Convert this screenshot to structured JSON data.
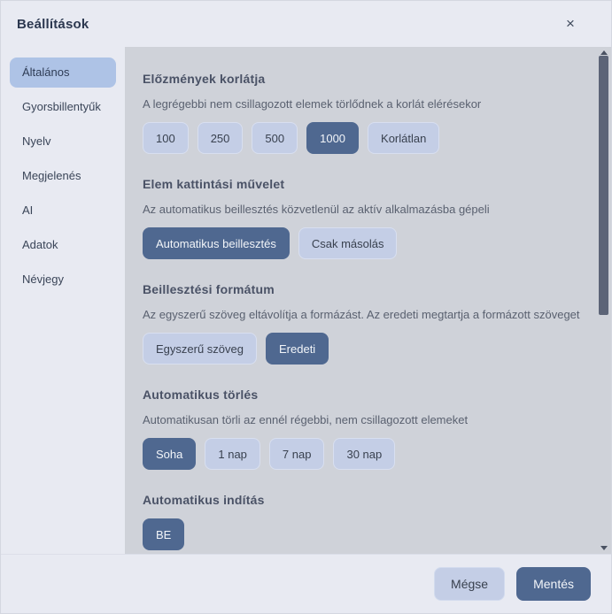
{
  "dialog": {
    "title": "Beállítások",
    "close_icon": "×"
  },
  "sidebar": {
    "items": [
      {
        "label": "Általános",
        "selected": true
      },
      {
        "label": "Gyorsbillentyűk",
        "selected": false
      },
      {
        "label": "Nyelv",
        "selected": false
      },
      {
        "label": "Megjelenés",
        "selected": false
      },
      {
        "label": "AI",
        "selected": false
      },
      {
        "label": "Adatok",
        "selected": false
      },
      {
        "label": "Névjegy",
        "selected": false
      }
    ]
  },
  "sections": [
    {
      "id": "history-limit",
      "title": "Előzmények korlátja",
      "description": "A legrégebbi nem csillagozott elemek törlődnek a korlát elérésekor",
      "options": [
        {
          "label": "100",
          "selected": false
        },
        {
          "label": "250",
          "selected": false
        },
        {
          "label": "500",
          "selected": false
        },
        {
          "label": "1000",
          "selected": true
        },
        {
          "label": "Korlátlan",
          "selected": false
        }
      ]
    },
    {
      "id": "item-click-action",
      "title": "Elem kattintási művelet",
      "description": "Az automatikus beillesztés közvetlenül az aktív alkalmazásba gépeli",
      "options": [
        {
          "label": "Automatikus beillesztés",
          "selected": true
        },
        {
          "label": "Csak másolás",
          "selected": false
        }
      ]
    },
    {
      "id": "paste-format",
      "title": "Beillesztési formátum",
      "description": "Az egyszerű szöveg eltávolítja a formázást. Az eredeti megtartja a formázott szöveget",
      "options": [
        {
          "label": "Egyszerű szöveg",
          "selected": false
        },
        {
          "label": "Eredeti",
          "selected": true
        }
      ]
    },
    {
      "id": "auto-delete",
      "title": "Automatikus törlés",
      "description": "Automatikusan törli az ennél régebbi, nem csillagozott elemeket",
      "options": [
        {
          "label": "Soha",
          "selected": true
        },
        {
          "label": "1 nap",
          "selected": false
        },
        {
          "label": "7 nap",
          "selected": false
        },
        {
          "label": "30 nap",
          "selected": false
        }
      ]
    },
    {
      "id": "auto-start",
      "title": "Automatikus indítás",
      "description": "",
      "options": [
        {
          "label": "BE",
          "selected": true
        }
      ]
    }
  ],
  "footer": {
    "cancel_label": "Mégse",
    "save_label": "Mentés"
  },
  "colors": {
    "accent": "#4f6890",
    "option_bg": "#c4cee6",
    "sidebar_selected_bg": "#aec3e6",
    "content_bg": "#cfd2d9",
    "chrome_bg": "#e8eaf2"
  }
}
